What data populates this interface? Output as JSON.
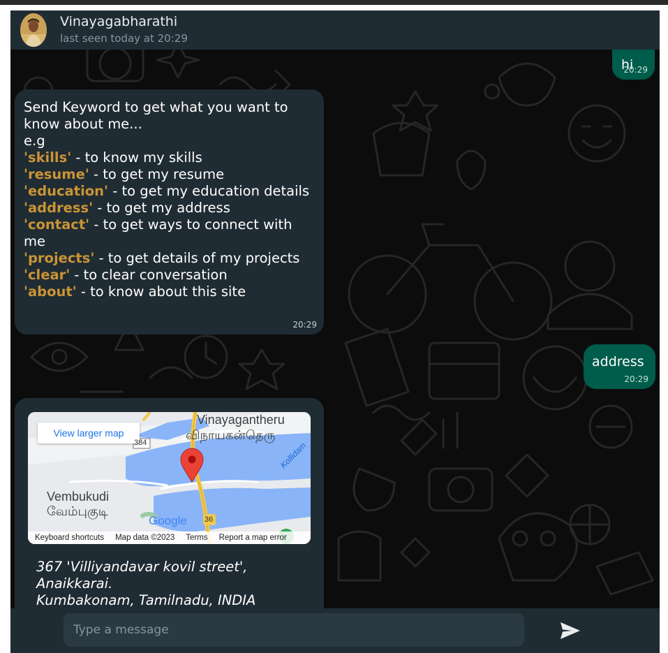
{
  "contact": {
    "name": "Vinayagabharathi",
    "status": "last seen today at 20:29",
    "avatar_icon": "avatar-photo"
  },
  "messages": [
    {
      "type": "outgoing",
      "text": "hi",
      "time": "20:29"
    },
    {
      "type": "incoming",
      "intro": "Send Keyword to get what you want to know about me...",
      "example": "e.g",
      "keywords": [
        {
          "keyword": "'skills'",
          "desc": " - to know my skills"
        },
        {
          "keyword": "'resume'",
          "desc": " - to get my resume"
        },
        {
          "keyword": "'education'",
          "desc": " - to get my education details"
        },
        {
          "keyword": "'address'",
          "desc": " - to get my address"
        },
        {
          "keyword": "'contact'",
          "desc": " - to get ways to connect with me"
        },
        {
          "keyword": "'projects'",
          "desc": " - to get details of my projects"
        },
        {
          "keyword": "'clear'",
          "desc": " - to clear conversation"
        },
        {
          "keyword": "'about'",
          "desc": " - to know about this site"
        }
      ],
      "time": "20:29"
    },
    {
      "type": "outgoing",
      "text": "address",
      "time": "20:29"
    },
    {
      "type": "incoming",
      "map": {
        "view_larger": "View larger map",
        "labels": {
          "vinayagantheru": "Vinayagantheru",
          "vinayagantheru_tamil": "விநாயகன்தெரு",
          "vembukudi": "Vembukudi",
          "vembukudi_tamil": "வேம்புகுடி",
          "kollidam": "Kollidam",
          "road_36": "36",
          "road_384": "384",
          "google": "Google"
        },
        "footer": {
          "shortcuts": "Keyboard shortcuts",
          "map_data": "Map data ©2023",
          "terms": "Terms",
          "report": "Report a map error"
        }
      },
      "address": {
        "line1": "367 'Villiyandavar kovil street',",
        "line2": "Anaikkarai.",
        "line3": "Kumbakonam, Tamilnadu, INDIA"
      }
    }
  ],
  "composer": {
    "placeholder": "Type a message",
    "send_icon": "send-icon"
  },
  "colors": {
    "header_bg": "#1f2c33",
    "incoming_bg": "#202c33",
    "outgoing_bg": "#005c4b",
    "keyword": "#c99436",
    "input_bg": "#2a3942"
  }
}
